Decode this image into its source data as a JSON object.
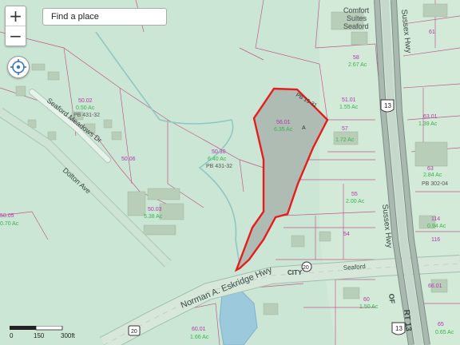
{
  "search": {
    "placeholder": "Find a place"
  },
  "zoom": {
    "in_label": "+",
    "out_label": "−"
  },
  "controls": {
    "locate_icon": "locate-crosshair-icon"
  },
  "scale": {
    "ticks": [
      "0",
      "150",
      "300ft"
    ]
  },
  "roads": {
    "seaford_meadows": "Seaford Meadows Dr",
    "dolton": "Dolton Ave",
    "eskridge": "Norman A. Eskridge Hwy",
    "sussex": "Sussex Hwy",
    "city": "CITY",
    "seaford": "Seaford",
    "rt13": "RT 13",
    "of": "OF"
  },
  "shields": {
    "r13a": "13",
    "r13b": "13",
    "r20a": "20",
    "r20b": "20"
  },
  "poi": {
    "line1": "Comfort",
    "line2": "Suites",
    "line3": "Seaford"
  },
  "subject_parcel": {
    "id": "56.01",
    "acres": "6.35 Ac",
    "mark": "A",
    "frontage": "PB 15-31"
  },
  "parcels": [
    {
      "id": "50.02",
      "acres": "0.50 Ac",
      "ref": "PB 431-32"
    },
    {
      "id": "50.06",
      "acres": "",
      "ref": ""
    },
    {
      "id": "50.30",
      "acres": "6.40 Ac",
      "ref": "PB 431-32"
    },
    {
      "id": "50.03",
      "acres": "5.38 Ac",
      "ref": ""
    },
    {
      "id": "50.05",
      "acres": "0.70 Ac",
      "ref": ""
    },
    {
      "id": "58",
      "acres": "2.67 Ac",
      "ref": ""
    },
    {
      "id": "51.01",
      "acres": "1.55 Ac",
      "ref": ""
    },
    {
      "id": "57",
      "acres": "1.72 Ac",
      "ref": ""
    },
    {
      "id": "55",
      "acres": "2.00 Ac",
      "ref": ""
    },
    {
      "id": "54",
      "acres": "",
      "ref": ""
    },
    {
      "id": "63.01",
      "acres": "1.39 Ac",
      "ref": ""
    },
    {
      "id": "63",
      "acres": "2.84 Ac",
      "ref": "PB 302-04"
    },
    {
      "id": "114",
      "acres": "0.94 Ac",
      "ref": ""
    },
    {
      "id": "116",
      "acres": "",
      "ref": ""
    },
    {
      "id": "66.01",
      "acres": "",
      "ref": ""
    },
    {
      "id": "65",
      "acres": "0.65 Ac",
      "ref": ""
    },
    {
      "id": "60.01",
      "acres": "1.66 Ac",
      "ref": ""
    },
    {
      "id": "60",
      "acres": "1.50 Ac",
      "ref": ""
    },
    {
      "id": "61",
      "acres": "",
      "ref": ""
    }
  ]
}
